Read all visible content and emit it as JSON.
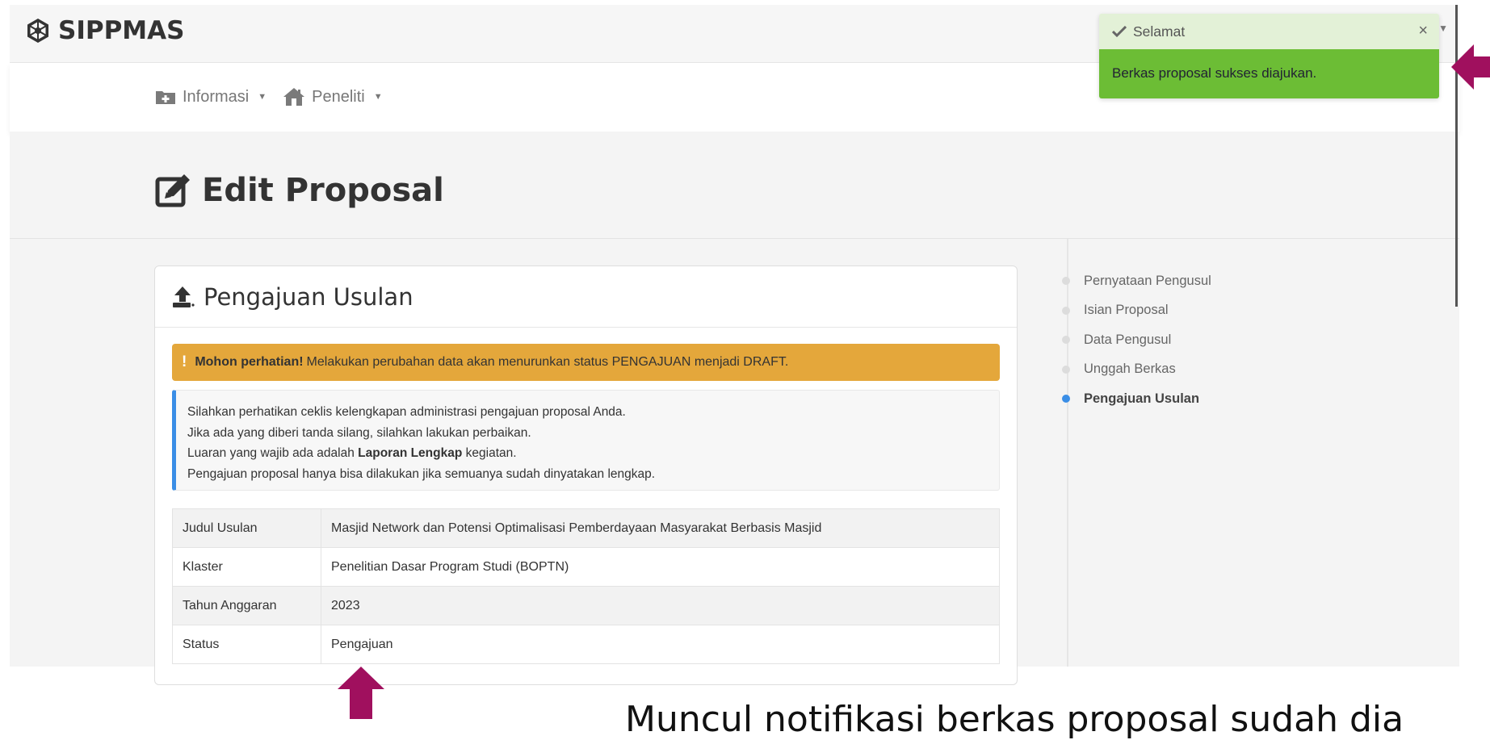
{
  "app": {
    "brand": "SIPPMAS"
  },
  "nav": {
    "items": [
      {
        "label": "Informasi",
        "icon": "folder-plus-icon"
      },
      {
        "label": "Peneliti",
        "icon": "home-icon"
      }
    ]
  },
  "page": {
    "title": "Edit Proposal"
  },
  "card": {
    "title": "Pengajuan Usulan",
    "warning": {
      "strong": "Mohon perhatian!",
      "text": "Melakukan perubahan data akan menurunkan status PENGAJUAN menjadi DRAFT."
    },
    "info": {
      "line1": "Silahkan perhatikan ceklis kelengkapan administrasi pengajuan proposal Anda.",
      "line2": "Jika ada yang diberi tanda silang, silahkan lakukan perbaikan.",
      "line3_pre": "Luaran yang wajib ada adalah",
      "line3_bold": "Laporan Lengkap",
      "line3_post": "kegiatan.",
      "line4": "Pengajuan proposal hanya bisa dilakukan jika semuanya sudah dinyatakan lengkap."
    },
    "rows": [
      {
        "label": "Judul Usulan",
        "value": "Masjid Network dan Potensi Optimalisasi Pemberdayaan Masyarakat Berbasis Masjid"
      },
      {
        "label": "Klaster",
        "value": "Penelitian Dasar Program Studi (BOPTN)"
      },
      {
        "label": "Tahun Anggaran",
        "value": "2023"
      },
      {
        "label": "Status",
        "value": "Pengajuan"
      }
    ]
  },
  "sidenav": {
    "items": [
      {
        "label": "Pernyataan Pengusul",
        "active": false
      },
      {
        "label": "Isian Proposal",
        "active": false
      },
      {
        "label": "Data Pengusul",
        "active": false
      },
      {
        "label": "Unggah Berkas",
        "active": false
      },
      {
        "label": "Pengajuan Usulan",
        "active": true
      }
    ]
  },
  "toast": {
    "title": "Selamat",
    "close": "×",
    "message": "Berkas proposal sukses diajukan."
  },
  "caption": {
    "text": "Muncul notifikasi berkas proposal sudah dia"
  },
  "colors": {
    "warning": "#e4a73b",
    "info_border": "#3a8ee6",
    "toast_header": "#e3f1d7",
    "toast_body": "#6cbd35",
    "annotation_arrow": "#a0105e"
  }
}
